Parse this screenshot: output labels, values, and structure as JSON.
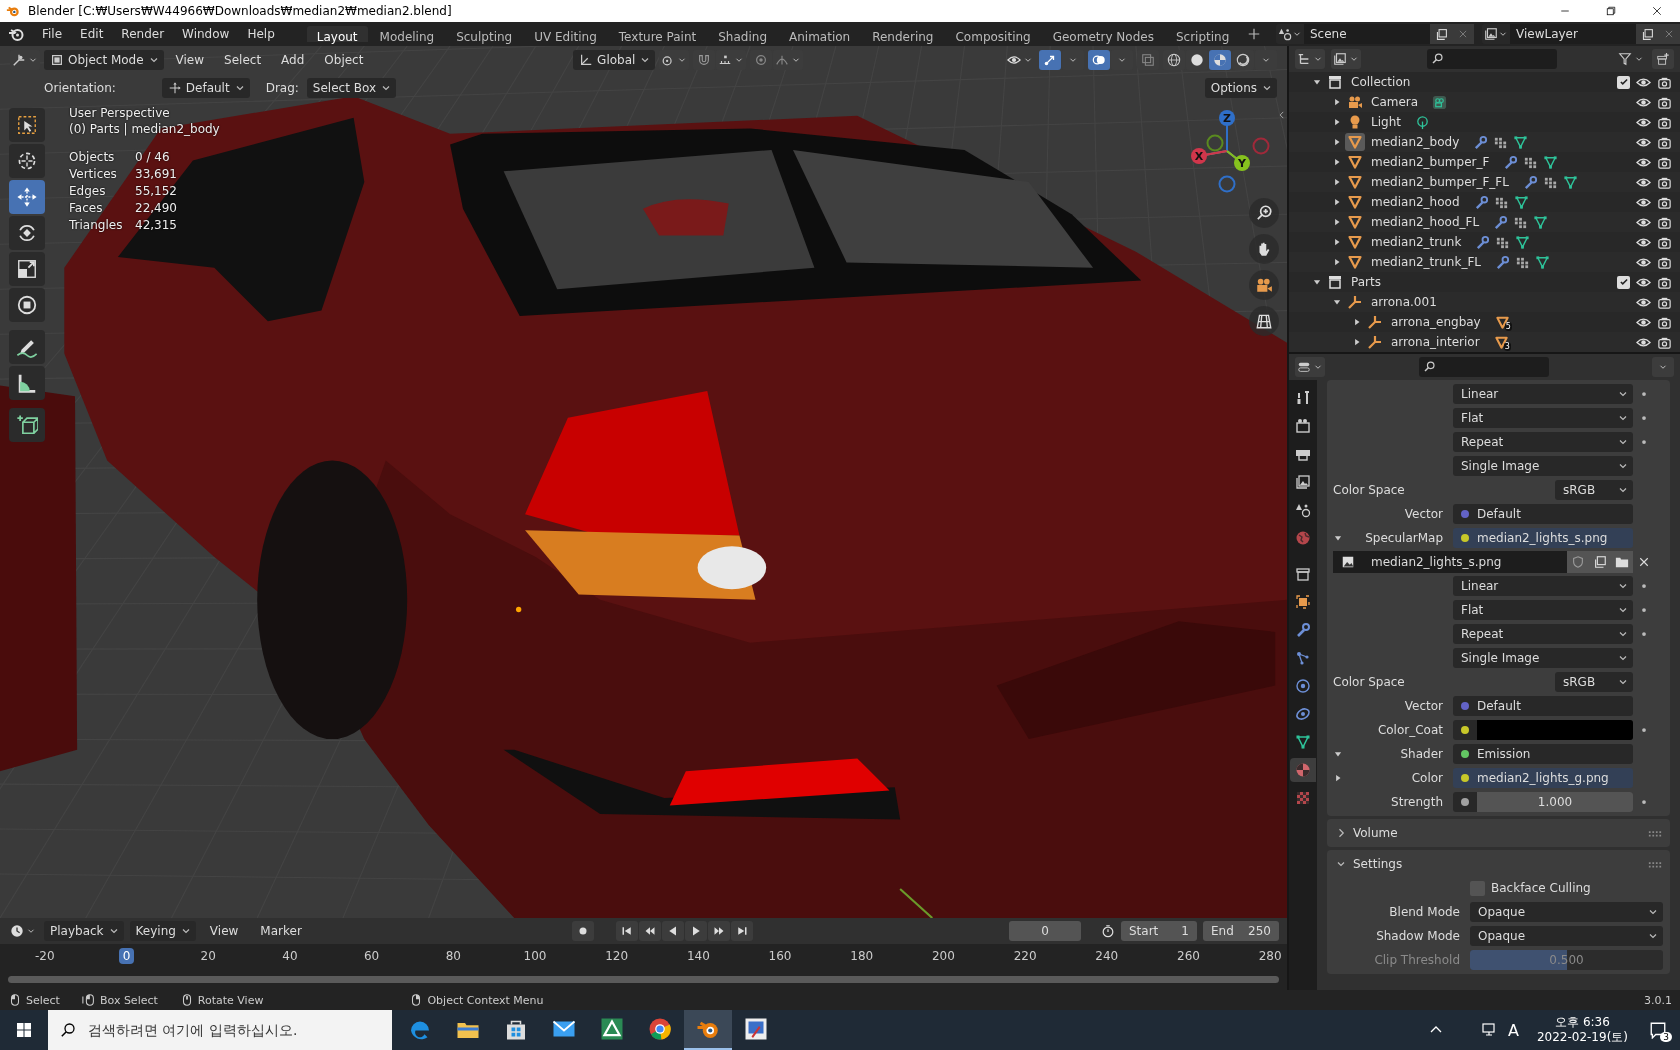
{
  "window": {
    "title": "Blender [C:₩Users₩W44966₩Downloads₩median2₩median2.blend]"
  },
  "menu": [
    "File",
    "Edit",
    "Render",
    "Window",
    "Help"
  ],
  "workspaces": [
    {
      "label": "Layout",
      "selected": true
    },
    {
      "label": "Modeling",
      "selected": false
    },
    {
      "label": "Sculpting",
      "selected": false
    },
    {
      "label": "UV Editing",
      "selected": false
    },
    {
      "label": "Texture Paint",
      "selected": false
    },
    {
      "label": "Shading",
      "selected": false
    },
    {
      "label": "Animation",
      "selected": false
    },
    {
      "label": "Rendering",
      "selected": false
    },
    {
      "label": "Compositing",
      "selected": false
    },
    {
      "label": "Geometry Nodes",
      "selected": false
    },
    {
      "label": "Scripting",
      "selected": false
    }
  ],
  "scene": "Scene",
  "view_layer": "ViewLayer",
  "viewport": {
    "mode": "Object Mode",
    "menus": [
      "View",
      "Select",
      "Add",
      "Object"
    ],
    "orientation": "Global",
    "shading": [
      {
        "kind": "wireframe",
        "selected": false
      },
      {
        "kind": "solid",
        "selected": false
      },
      {
        "kind": "material",
        "selected": true
      },
      {
        "kind": "rendered",
        "selected": false
      }
    ],
    "tool_settings": {
      "orientation_label": "Orientation:",
      "orientation": "Default",
      "drag_label": "Drag:",
      "drag": "Select Box",
      "options": "Options"
    },
    "info": {
      "perspective": "User Perspective",
      "context": "(0) Parts | median2_body",
      "stats": [
        {
          "label": "Objects",
          "value": "0 / 46"
        },
        {
          "label": "Vertices",
          "value": "33,691"
        },
        {
          "label": "Edges",
          "value": "55,152"
        },
        {
          "label": "Faces",
          "value": "22,490"
        },
        {
          "label": "Triangles",
          "value": "42,315"
        }
      ]
    },
    "tools": [
      {
        "kind": "select-box",
        "selected": false
      },
      {
        "kind": "cursor",
        "selected": false
      },
      {
        "kind": "move",
        "selected": true
      },
      {
        "kind": "rotate",
        "selected": false
      },
      {
        "kind": "scale",
        "selected": false
      },
      {
        "kind": "transform",
        "selected": false
      },
      {
        "kind": "annotate",
        "selected": false
      },
      {
        "kind": "measure",
        "selected": false
      },
      {
        "kind": "add-cube",
        "selected": false
      }
    ],
    "gizmo": {
      "z": "Z",
      "x": "X",
      "y": "Y"
    }
  },
  "outliner": [
    {
      "name": "Collection",
      "kind": "collection",
      "expanded": true,
      "checked": true,
      "children": [
        {
          "name": "Camera",
          "kind": "camera",
          "expanded": false,
          "active": false
        },
        {
          "name": "Light",
          "kind": "light",
          "expanded": false,
          "active": false
        },
        {
          "name": "median2_body",
          "kind": "mesh",
          "expanded": false,
          "active": true
        },
        {
          "name": "median2_bumper_F",
          "kind": "mesh",
          "expanded": false,
          "active": false
        },
        {
          "name": "median2_bumper_F_FL",
          "kind": "mesh",
          "expanded": false,
          "active": false
        },
        {
          "name": "median2_hood",
          "kind": "mesh",
          "expanded": false,
          "active": false
        },
        {
          "name": "median2_hood_FL",
          "kind": "mesh",
          "expanded": false,
          "active": false
        },
        {
          "name": "median2_trunk",
          "kind": "mesh",
          "expanded": false,
          "active": false
        },
        {
          "name": "median2_trunk_FL",
          "kind": "mesh",
          "expanded": false,
          "active": false
        }
      ]
    },
    {
      "name": "Parts",
      "kind": "collection",
      "expanded": true,
      "checked": true,
      "children": [
        {
          "name": "arrona.001",
          "kind": "empty",
          "expanded": true,
          "active": false,
          "children": [
            {
              "name": "arrona_engbay",
              "kind": "empty",
              "expanded": false,
              "active": false,
              "child_count": "5"
            },
            {
              "name": "arrona_interior",
              "kind": "empty",
              "expanded": false,
              "active": false,
              "child_count": "3"
            }
          ]
        }
      ]
    }
  ],
  "properties": {
    "tabs": [
      {
        "kind": "tool",
        "selected": false
      },
      {
        "kind": "render",
        "selected": false
      },
      {
        "kind": "output",
        "selected": false
      },
      {
        "kind": "view-layer",
        "selected": false
      },
      {
        "kind": "scene",
        "selected": false
      },
      {
        "kind": "world",
        "selected": false
      },
      {
        "kind": "collection",
        "selected": false
      },
      {
        "kind": "object",
        "selected": false
      },
      {
        "kind": "modifier",
        "selected": false
      },
      {
        "kind": "particles",
        "selected": false
      },
      {
        "kind": "physics",
        "selected": false
      },
      {
        "kind": "constraints",
        "selected": false
      },
      {
        "kind": "data",
        "selected": false
      },
      {
        "kind": "material",
        "selected": true
      },
      {
        "kind": "texture",
        "selected": false
      }
    ],
    "rows": [
      {
        "kind": "dropdown",
        "value": "Linear",
        "keyframe_dot": true
      },
      {
        "kind": "dropdown",
        "value": "Flat",
        "keyframe_dot": true
      },
      {
        "kind": "dropdown",
        "value": "Repeat",
        "keyframe_dot": true
      },
      {
        "kind": "dropdown",
        "value": "Single Image",
        "keyframe_dot": false
      },
      {
        "kind": "setting",
        "label": "Color Space",
        "value": "sRGB"
      },
      {
        "kind": "socket",
        "label": "Vector",
        "value": "Default",
        "color": "#6363c7",
        "linked": false
      },
      {
        "kind": "socket",
        "label": "SpecularMap",
        "value": "median2_lights_s.png",
        "color": "#c7c729",
        "linked": true,
        "expanded": true
      },
      {
        "kind": "image",
        "value": "median2_lights_s.png"
      },
      {
        "kind": "dropdown",
        "value": "Linear",
        "keyframe_dot": true
      },
      {
        "kind": "dropdown",
        "value": "Flat",
        "keyframe_dot": true
      },
      {
        "kind": "dropdown",
        "value": "Repeat",
        "keyframe_dot": true
      },
      {
        "kind": "dropdown",
        "value": "Single Image",
        "keyframe_dot": false
      },
      {
        "kind": "setting",
        "label": "Color Space",
        "value": "sRGB"
      },
      {
        "kind": "socket",
        "label": "Vector",
        "value": "Default",
        "color": "#6363c7",
        "linked": false
      },
      {
        "kind": "color",
        "label": "Color_Coat",
        "color": "#c7c729",
        "swatch": {
          "color": "#000000"
        },
        "keyframe_dot": true
      },
      {
        "kind": "socket",
        "label": "Shader",
        "value": "Emission",
        "color": "#63c763",
        "linked": false,
        "expanded": true
      },
      {
        "kind": "socket",
        "label": "Color",
        "value": "median2_lights_g.png",
        "color": "#c7c729",
        "linked": true,
        "expanded": false
      },
      {
        "kind": "number",
        "label": "Strength",
        "value": "1.000",
        "color": "#a1a1a1",
        "keyframe_dot": true
      }
    ],
    "volume_panel": {
      "title": "Volume",
      "expanded": false
    },
    "settings_panel": {
      "title": "Settings",
      "expanded": true,
      "backface_culling": {
        "label": "Backface Culling",
        "checked": false
      },
      "rows": [
        {
          "label": "Blend Mode",
          "value": "Opaque"
        },
        {
          "label": "Shadow Mode",
          "value": "Opaque"
        }
      ],
      "clip": {
        "label": "Clip Threshold",
        "value": "0.500",
        "level": 0.5,
        "disabled": true
      }
    }
  },
  "timeline": {
    "menus": [
      "Playback",
      "Keying",
      "View",
      "Marker"
    ],
    "current_frame": "0",
    "start_label": "Start",
    "start": "1",
    "end_label": "End",
    "end": "250",
    "ruler": [
      {
        "label": "-20",
        "selected": false
      },
      {
        "label": "0",
        "selected": true
      },
      {
        "label": "20",
        "selected": false
      },
      {
        "label": "40",
        "selected": false
      },
      {
        "label": "60",
        "selected": false
      },
      {
        "label": "80",
        "selected": false
      },
      {
        "label": "100",
        "selected": false
      },
      {
        "label": "120",
        "selected": false
      },
      {
        "label": "140",
        "selected": false
      },
      {
        "label": "160",
        "selected": false
      },
      {
        "label": "180",
        "selected": false
      },
      {
        "label": "200",
        "selected": false
      },
      {
        "label": "220",
        "selected": false
      },
      {
        "label": "240",
        "selected": false
      },
      {
        "label": "260",
        "selected": false
      },
      {
        "label": "280",
        "selected": false
      }
    ]
  },
  "status_bar": {
    "items": [
      {
        "kind": "mouse-left",
        "label": "Select"
      },
      {
        "kind": "mouse-drag",
        "label": "Box Select"
      },
      {
        "kind": "mouse-middle",
        "label": "Rotate View"
      },
      {
        "kind": "mouse-right",
        "label": "Object Context Menu"
      }
    ],
    "version": "3.0.1"
  },
  "taskbar": {
    "search_placeholder": "검색하려면 여기에 입력하십시오.",
    "apps": [
      {
        "kind": "edge",
        "active": false
      },
      {
        "kind": "folder",
        "active": false
      },
      {
        "kind": "store",
        "active": false
      },
      {
        "kind": "mail",
        "active": false
      },
      {
        "kind": "map",
        "active": false
      },
      {
        "kind": "chrome",
        "active": false
      },
      {
        "kind": "blender",
        "active": true
      },
      {
        "kind": "paint",
        "active": false
      }
    ],
    "ime": "A",
    "time": "오후 6:36",
    "date": "2022-02-19(토)",
    "notifications": "3"
  }
}
